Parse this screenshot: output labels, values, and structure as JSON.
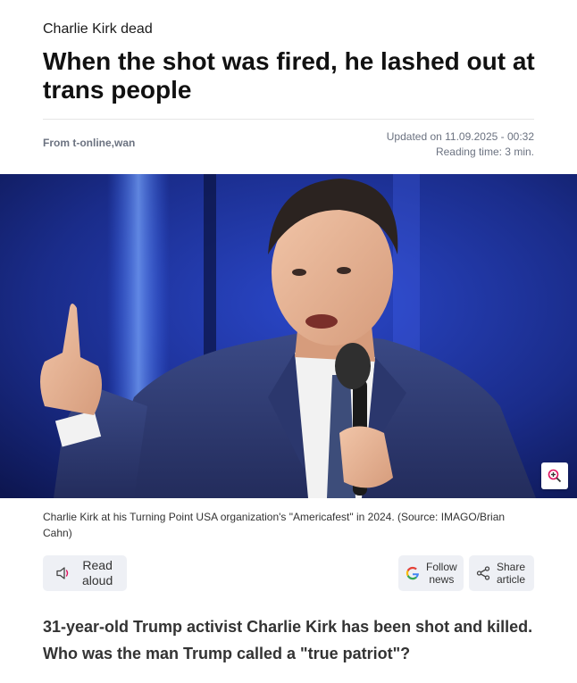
{
  "article": {
    "kicker": "Charlie Kirk dead",
    "headline": "When the shot was fired, he lashed out at trans people",
    "source": "From t-online,wan",
    "updated": "Updated on 11.09.2025 - 00:32",
    "reading_time": "Reading time: 3 min.",
    "caption": "Charlie Kirk at his Turning Point USA organization's \"Americafest\" in 2024. (Source: IMAGO/Brian Cahn)",
    "lead": "31-year-old Trump activist Charlie Kirk has been shot and killed. Who was the man Trump called a \"true patriot\"?"
  },
  "actions": {
    "read_aloud": {
      "line1": "Read",
      "line2": "aloud",
      "icon": "speaker-icon"
    },
    "follow_news": {
      "line1": "Follow",
      "line2": "news",
      "icon": "google-icon"
    },
    "share_article": {
      "line1": "Share",
      "line2": "article",
      "icon": "share-icon"
    }
  },
  "colors": {
    "photo_background": "#1c2b7a",
    "button_background": "#eef0f5",
    "accent_pink": "#e0115f"
  }
}
